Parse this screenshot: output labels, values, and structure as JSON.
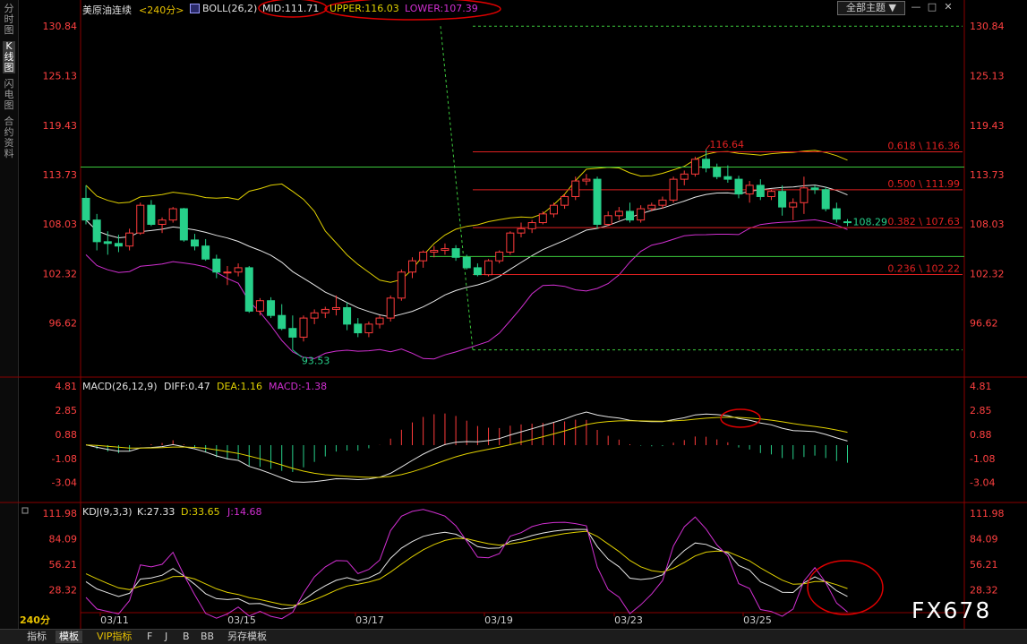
{
  "side_tabs": [
    "分时图",
    "K线图",
    "闪电图",
    "合约资料"
  ],
  "legend": {
    "title": "美原油连续",
    "period": "<240分>",
    "boll_name": "BOLL(26,2)",
    "mid": "MID:111.71",
    "upper": "UPPER:116.03",
    "lower": "LOWER:107.39"
  },
  "theme_button": "全部主题",
  "window_buttons": [
    "—",
    "□",
    "✕"
  ],
  "price_axis": [
    "130.84",
    "125.13",
    "119.43",
    "113.73",
    "108.03",
    "102.32",
    "96.62"
  ],
  "fib_levels": [
    {
      "label": "0.618 \\ 116.36",
      "value": 116.36
    },
    {
      "label": "0.500 \\ 111.99",
      "value": 111.99
    },
    {
      "label": "0.382 \\ 107.63",
      "value": 107.63
    },
    {
      "label": "0.236 \\ 102.22",
      "value": 102.22
    }
  ],
  "price_marks": {
    "high": "116.64",
    "low": "93.53",
    "last": "108.29"
  },
  "macd": {
    "label": "MACD(26,12,9)",
    "diff": "DIFF:0.47",
    "dea": "DEA:1.16",
    "macd": "MACD:-1.38",
    "axis": [
      "4.81",
      "2.85",
      "0.88",
      "-1.08",
      "-3.04"
    ]
  },
  "kdj": {
    "label": "KDJ(9,3,3)",
    "k": "K:27.33",
    "d": "D:33.65",
    "j": "J:14.68",
    "axis": [
      "111.98",
      "84.09",
      "56.21",
      "28.32"
    ]
  },
  "period_tag": "240分",
  "dates": [
    "03/11",
    "03/15",
    "03/17",
    "03/19",
    "03/23",
    "03/25"
  ],
  "bottom_tabs": [
    "指标",
    "模板",
    "VIP指标",
    "F",
    "J",
    "B",
    "BB",
    "另存模板"
  ],
  "watermark": "FX678",
  "colors": {
    "up": "#ff3b3b",
    "down": "#27d08a",
    "mid": "#e6e6e6",
    "upper": "#e0d000",
    "lower": "#d12fd1",
    "fib": "#e02020",
    "hline": "#3cc93c",
    "axis": "#ff4040",
    "grid": "#7a0000"
  },
  "chart_data": {
    "type": "candlestick",
    "price_range": [
      90.5,
      132.0
    ],
    "high": 116.64,
    "low": 93.53,
    "last": 108.29,
    "candles": [
      [
        111.0,
        112.5,
        108.0,
        108.5
      ],
      [
        108.5,
        109.2,
        105.0,
        106.0
      ],
      [
        106.0,
        107.2,
        104.5,
        105.8
      ],
      [
        105.8,
        106.8,
        104.8,
        105.5
      ],
      [
        105.5,
        107.5,
        105.0,
        107.0
      ],
      [
        107.0,
        110.5,
        106.8,
        110.2
      ],
      [
        110.2,
        110.8,
        107.8,
        108.0
      ],
      [
        108.0,
        108.8,
        107.0,
        108.5
      ],
      [
        108.5,
        110.0,
        108.2,
        109.8
      ],
      [
        109.8,
        109.9,
        106.0,
        106.2
      ],
      [
        106.2,
        106.9,
        105.0,
        105.5
      ],
      [
        105.5,
        106.3,
        103.8,
        104.0
      ],
      [
        104.0,
        104.5,
        101.8,
        102.5
      ],
      [
        102.5,
        103.2,
        101.0,
        102.5
      ],
      [
        102.5,
        103.5,
        102.0,
        103.0
      ],
      [
        103.0,
        103.2,
        97.8,
        98.0
      ],
      [
        98.0,
        99.5,
        97.5,
        99.2
      ],
      [
        99.2,
        99.6,
        97.2,
        97.5
      ],
      [
        97.5,
        98.8,
        95.8,
        96.0
      ],
      [
        96.0,
        97.5,
        93.53,
        95.0
      ],
      [
        95.0,
        97.5,
        94.5,
        97.2
      ],
      [
        97.2,
        98.2,
        96.5,
        97.8
      ],
      [
        97.8,
        98.5,
        97.2,
        98.2
      ],
      [
        98.2,
        99.8,
        97.5,
        98.4
      ],
      [
        98.4,
        99.0,
        95.8,
        96.5
      ],
      [
        96.5,
        97.2,
        95.0,
        95.5
      ],
      [
        95.5,
        96.8,
        95.0,
        96.5
      ],
      [
        96.5,
        97.5,
        96.0,
        97.2
      ],
      [
        97.2,
        99.8,
        96.8,
        99.5
      ],
      [
        99.5,
        102.8,
        99.2,
        102.5
      ],
      [
        102.5,
        104.2,
        101.8,
        103.8
      ],
      [
        103.8,
        105.0,
        103.0,
        104.8
      ],
      [
        104.8,
        105.5,
        104.2,
        105.0
      ],
      [
        105.0,
        105.8,
        104.5,
        105.2
      ],
      [
        105.2,
        105.6,
        103.8,
        104.2
      ],
      [
        104.2,
        104.5,
        102.8,
        103.0
      ],
      [
        103.0,
        103.5,
        102.0,
        102.2
      ],
      [
        102.2,
        104.0,
        102.0,
        103.8
      ],
      [
        103.8,
        105.0,
        103.5,
        104.8
      ],
      [
        104.8,
        107.2,
        104.5,
        107.0
      ],
      [
        107.0,
        108.2,
        106.5,
        107.5
      ],
      [
        107.5,
        108.5,
        107.0,
        108.2
      ],
      [
        108.2,
        109.5,
        108.0,
        109.2
      ],
      [
        109.2,
        110.5,
        108.8,
        110.2
      ],
      [
        110.2,
        111.5,
        109.8,
        111.2
      ],
      [
        111.2,
        113.5,
        110.8,
        113.0
      ],
      [
        113.0,
        113.8,
        112.5,
        113.2
      ],
      [
        113.2,
        113.5,
        107.5,
        108.0
      ],
      [
        108.0,
        109.5,
        107.8,
        109.0
      ],
      [
        109.0,
        110.0,
        108.5,
        109.5
      ],
      [
        109.5,
        110.5,
        108.2,
        108.5
      ],
      [
        108.5,
        110.2,
        108.2,
        109.8
      ],
      [
        109.8,
        110.5,
        109.5,
        110.2
      ],
      [
        110.2,
        111.2,
        109.8,
        110.8
      ],
      [
        110.8,
        113.5,
        110.5,
        113.2
      ],
      [
        113.2,
        114.2,
        112.5,
        113.8
      ],
      [
        113.8,
        115.8,
        113.5,
        115.5
      ],
      [
        115.5,
        116.64,
        114.0,
        114.5
      ],
      [
        114.5,
        115.0,
        113.2,
        113.5
      ],
      [
        113.5,
        114.8,
        112.8,
        113.2
      ],
      [
        113.2,
        113.6,
        111.0,
        111.5
      ],
      [
        111.5,
        113.0,
        110.5,
        112.5
      ],
      [
        112.5,
        113.2,
        110.8,
        111.2
      ],
      [
        111.2,
        112.0,
        110.8,
        111.8
      ],
      [
        111.8,
        112.5,
        109.0,
        110.0
      ],
      [
        110.0,
        111.0,
        108.5,
        110.5
      ],
      [
        110.5,
        113.5,
        109.2,
        112.2
      ],
      [
        112.2,
        112.5,
        111.5,
        112.0
      ],
      [
        112.0,
        112.3,
        109.5,
        109.8
      ],
      [
        109.8,
        110.5,
        108.2,
        108.6
      ],
      [
        108.3,
        108.6,
        107.8,
        108.29
      ]
    ],
    "macd": {
      "range": [
        -4.6,
        5.4
      ],
      "diff_last": 0.47,
      "dea_last": 1.16,
      "macd_last": -1.38
    },
    "kdj": {
      "range": [
        5,
        122
      ],
      "k_last": 27.33,
      "d_last": 33.65,
      "j_last": 14.68
    }
  }
}
